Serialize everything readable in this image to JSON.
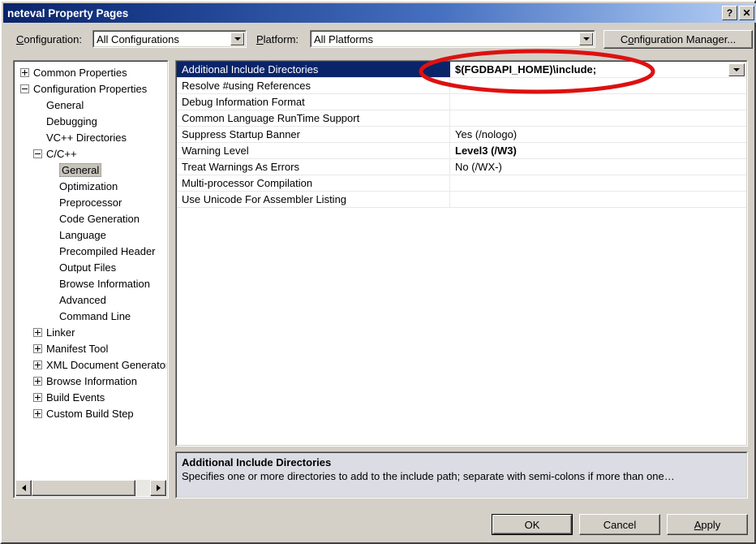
{
  "window": {
    "title": "neteval Property Pages",
    "help_button": "?",
    "close_button": "✕"
  },
  "toolbar": {
    "configuration_label": "Configuration:",
    "configuration_value": "All Configurations",
    "platform_label": "Platform:",
    "platform_value": "All Platforms",
    "config_manager_label": "Configuration Manager..."
  },
  "tree": {
    "items": [
      {
        "label": "Common Properties",
        "indent": 0,
        "expander": "plus",
        "selected": false
      },
      {
        "label": "Configuration Properties",
        "indent": 0,
        "expander": "minus",
        "selected": false
      },
      {
        "label": "General",
        "indent": 1,
        "expander": "none",
        "selected": false
      },
      {
        "label": "Debugging",
        "indent": 1,
        "expander": "none",
        "selected": false
      },
      {
        "label": "VC++ Directories",
        "indent": 1,
        "expander": "none",
        "selected": false
      },
      {
        "label": "C/C++",
        "indent": 1,
        "expander": "minus",
        "selected": false
      },
      {
        "label": "General",
        "indent": 2,
        "expander": "none",
        "selected": true
      },
      {
        "label": "Optimization",
        "indent": 2,
        "expander": "none",
        "selected": false
      },
      {
        "label": "Preprocessor",
        "indent": 2,
        "expander": "none",
        "selected": false
      },
      {
        "label": "Code Generation",
        "indent": 2,
        "expander": "none",
        "selected": false
      },
      {
        "label": "Language",
        "indent": 2,
        "expander": "none",
        "selected": false
      },
      {
        "label": "Precompiled Header",
        "indent": 2,
        "expander": "none",
        "selected": false
      },
      {
        "label": "Output Files",
        "indent": 2,
        "expander": "none",
        "selected": false
      },
      {
        "label": "Browse Information",
        "indent": 2,
        "expander": "none",
        "selected": false
      },
      {
        "label": "Advanced",
        "indent": 2,
        "expander": "none",
        "selected": false
      },
      {
        "label": "Command Line",
        "indent": 2,
        "expander": "none",
        "selected": false
      },
      {
        "label": "Linker",
        "indent": 1,
        "expander": "plus",
        "selected": false
      },
      {
        "label": "Manifest Tool",
        "indent": 1,
        "expander": "plus",
        "selected": false
      },
      {
        "label": "XML Document Generator",
        "indent": 1,
        "expander": "plus",
        "selected": false
      },
      {
        "label": "Browse Information",
        "indent": 1,
        "expander": "plus",
        "selected": false
      },
      {
        "label": "Build Events",
        "indent": 1,
        "expander": "plus",
        "selected": false
      },
      {
        "label": "Custom Build Step",
        "indent": 1,
        "expander": "plus",
        "selected": false
      }
    ]
  },
  "grid": {
    "rows": [
      {
        "name": "Additional Include Directories",
        "value": "$(FGDBAPI_HOME)\\include;",
        "selected": true,
        "bold": true,
        "dropdown": true
      },
      {
        "name": "Resolve #using References",
        "value": "",
        "selected": false,
        "bold": false,
        "dropdown": false
      },
      {
        "name": "Debug Information Format",
        "value": "",
        "selected": false,
        "bold": false,
        "dropdown": false
      },
      {
        "name": "Common Language RunTime Support",
        "value": "",
        "selected": false,
        "bold": false,
        "dropdown": false
      },
      {
        "name": "Suppress Startup Banner",
        "value": "Yes (/nologo)",
        "selected": false,
        "bold": false,
        "dropdown": false
      },
      {
        "name": "Warning Level",
        "value": "Level3 (/W3)",
        "selected": false,
        "bold": true,
        "dropdown": false
      },
      {
        "name": "Treat Warnings As Errors",
        "value": "No (/WX-)",
        "selected": false,
        "bold": false,
        "dropdown": false
      },
      {
        "name": "Multi-processor Compilation",
        "value": "",
        "selected": false,
        "bold": false,
        "dropdown": false
      },
      {
        "name": "Use Unicode For Assembler Listing",
        "value": "",
        "selected": false,
        "bold": false,
        "dropdown": false
      }
    ]
  },
  "description": {
    "title": "Additional Include Directories",
    "text": "Specifies one or more directories to add to the include path; separate with semi-colons if more than one…"
  },
  "footer": {
    "ok_label": "OK",
    "cancel_label": "Cancel",
    "apply_label": "Apply"
  },
  "annotation": {
    "shape": "red-ellipse",
    "color": "#dd1111",
    "target": "Additional Include Directories value"
  }
}
